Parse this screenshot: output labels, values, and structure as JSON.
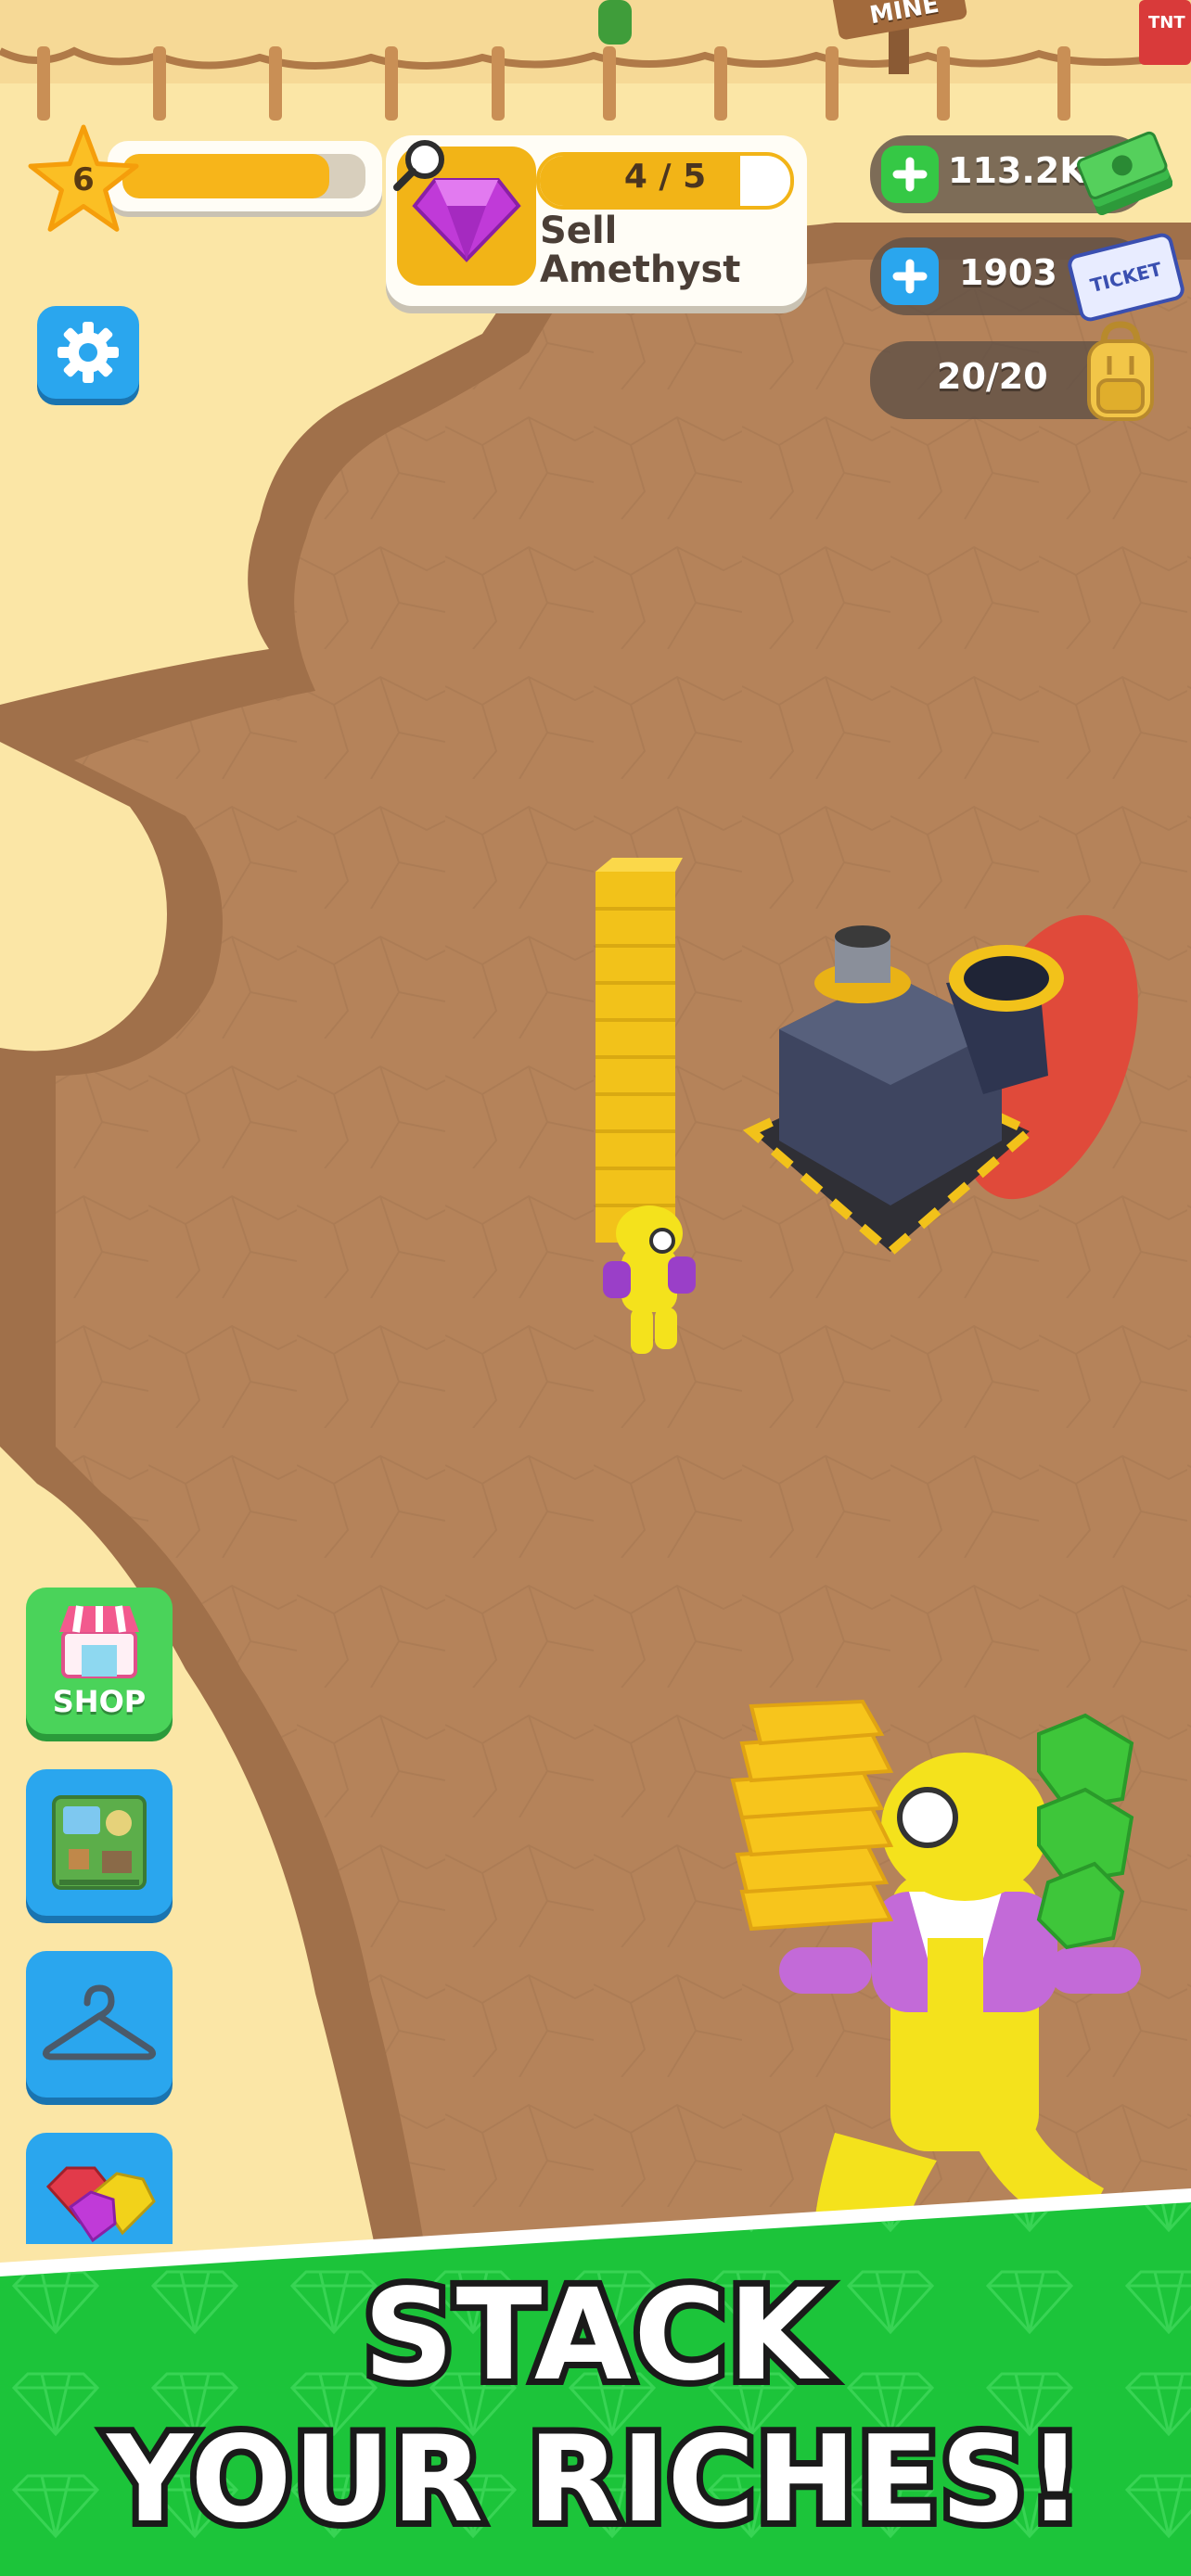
{
  "hud": {
    "level": "6",
    "level_progress": 0.85,
    "quest": {
      "progress_text": "4 / 5",
      "progress": 0.8,
      "title_line1": "Sell",
      "title_line2": "Amethyst"
    },
    "cash": "113.2K",
    "tickets": "1903",
    "ticket_label": "TICKET",
    "backpack": "20/20"
  },
  "side_menu": {
    "shop_label": "SHOP"
  },
  "scenery": {
    "mine_sign": "MINE",
    "tnt_label": "TNT"
  },
  "promo": {
    "line1": "STACK",
    "line2": "YOUR RICHES!"
  },
  "colors": {
    "sand": "#fbe6a6",
    "dirt": "#b5835a",
    "cliff": "#a0704a",
    "banner_green": "#1cc43a",
    "gold": "#f7c51c",
    "accent_blue": "#2aa6ee",
    "gem_purple": "#c03ad8"
  },
  "icons": [
    "star-icon",
    "amethyst-gem-icon",
    "magnifier-icon",
    "cash-icon",
    "ticket-icon",
    "backpack-icon",
    "gear-icon",
    "shop-icon",
    "map-icon",
    "hanger-icon",
    "gems-icon"
  ]
}
